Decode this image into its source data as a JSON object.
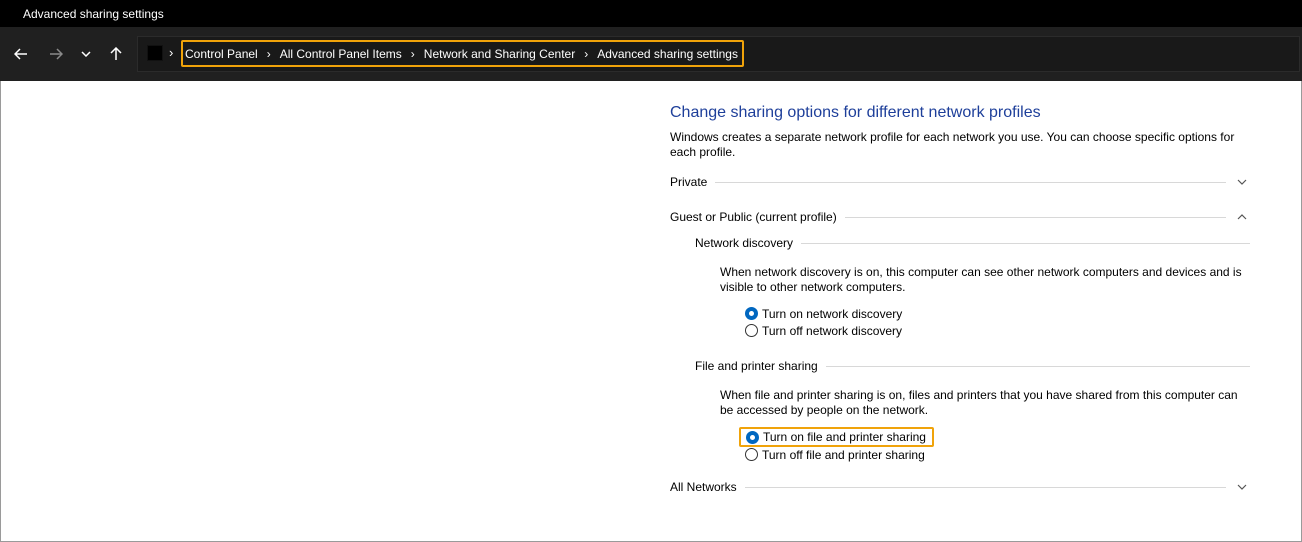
{
  "window": {
    "title": "Advanced sharing settings"
  },
  "nav": {
    "breadcrumbs": [
      "Control Panel",
      "All Control Panel Items",
      "Network and Sharing Center",
      "Advanced sharing settings"
    ],
    "back_icon": "arrow-left-icon",
    "forward_icon": "arrow-right-icon",
    "recent_icon": "chevron-down-icon",
    "up_icon": "arrow-up-icon"
  },
  "main": {
    "heading": "Change sharing options for different network profiles",
    "description": "Windows creates a separate network profile for each network you use. You can choose specific options for each profile.",
    "profiles": {
      "private": {
        "label": "Private",
        "expanded": false
      },
      "guest": {
        "label": "Guest or Public (current profile)",
        "expanded": true
      },
      "all": {
        "label": "All Networks",
        "expanded": false
      }
    },
    "network_discovery": {
      "label": "Network discovery",
      "description": "When network discovery is on, this computer can see other network computers and devices and is visible to other network computers.",
      "options": [
        {
          "label": "Turn on network discovery",
          "selected": true
        },
        {
          "label": "Turn off network discovery",
          "selected": false
        }
      ]
    },
    "file_sharing": {
      "label": "File and printer sharing",
      "description": "When file and printer sharing is on, files and printers that you have shared from this computer can be accessed by people on the network.",
      "options": [
        {
          "label": "Turn on file and printer sharing",
          "selected": true
        },
        {
          "label": "Turn off file and printer sharing",
          "selected": false
        }
      ]
    }
  },
  "colors": {
    "heading": "#1e3f9a",
    "highlight": "#f0a30a",
    "radio_selected": "#0067c0",
    "titlebar": "#000000",
    "navbar": "#202020"
  }
}
